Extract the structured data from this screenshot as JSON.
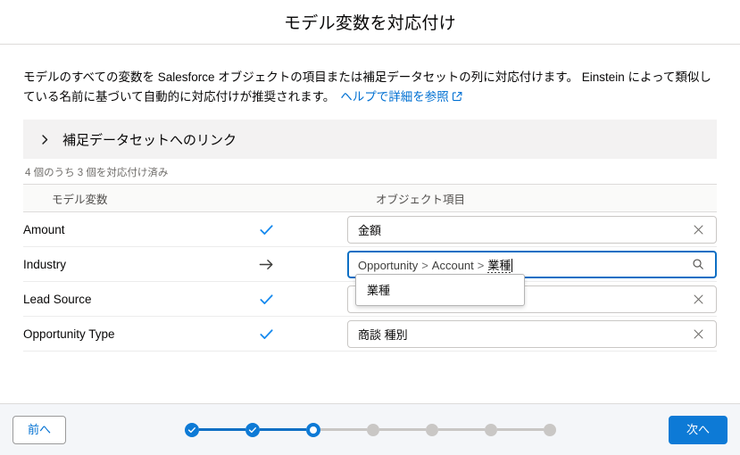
{
  "header": {
    "title": "モデル変数を対応付け"
  },
  "intro": {
    "text": "モデルのすべての変数を Salesforce オブジェクトの項目または補足データセットの列に対応付けます。 Einstein によって類似している名前に基づいて自動的に対応付けが推奨されます。",
    "help_link": "ヘルプで詳細を参照",
    "help_icon": "external-link-icon"
  },
  "accordion": {
    "label": "補足データセットへのリンク",
    "icon": "chevron-right-icon",
    "expanded": false
  },
  "mapping_status": "4 個のうち 3 個を対応付け済み",
  "table": {
    "columns": [
      "モデル変数",
      "オブジェクト項目"
    ],
    "rows": [
      {
        "variable": "Amount",
        "status_icon": "check-icon",
        "field_value": "金額",
        "action_icon": "close-icon",
        "focused": false
      },
      {
        "variable": "Industry",
        "status_icon": "arrow-right-icon",
        "field_value": "Opportunity > Account > 業種",
        "field_path": [
          "Opportunity",
          "Account"
        ],
        "field_composition": "業種",
        "action_icon": "search-icon",
        "focused": true
      },
      {
        "variable": "Lead Source",
        "status_icon": "check-icon",
        "field_value": "",
        "action_icon": "close-icon",
        "focused": false
      },
      {
        "variable": "Opportunity Type",
        "status_icon": "check-icon",
        "field_value": "商談 種別",
        "action_icon": "close-icon",
        "focused": false
      }
    ]
  },
  "ime_popup": {
    "candidates": [
      "業種"
    ]
  },
  "footer": {
    "previous_label": "前へ",
    "next_label": "次へ",
    "progress": {
      "total_steps": 7,
      "current_step": 3,
      "steps": [
        {
          "state": "done"
        },
        {
          "state": "done"
        },
        {
          "state": "current"
        },
        {
          "state": "todo"
        },
        {
          "state": "todo"
        },
        {
          "state": "todo"
        },
        {
          "state": "todo"
        }
      ]
    }
  },
  "colors": {
    "brand_blue": "#0d7ad6",
    "link_blue": "#0070d2",
    "focus_blue": "#0d6fc4",
    "check_blue": "#1589ee",
    "border_gray": "#dddbda",
    "header_gray": "#fafaf9",
    "accordion_gray": "#f3f2f2",
    "footer_gray": "#f4f6f9",
    "muted_text": "#706e6b"
  }
}
